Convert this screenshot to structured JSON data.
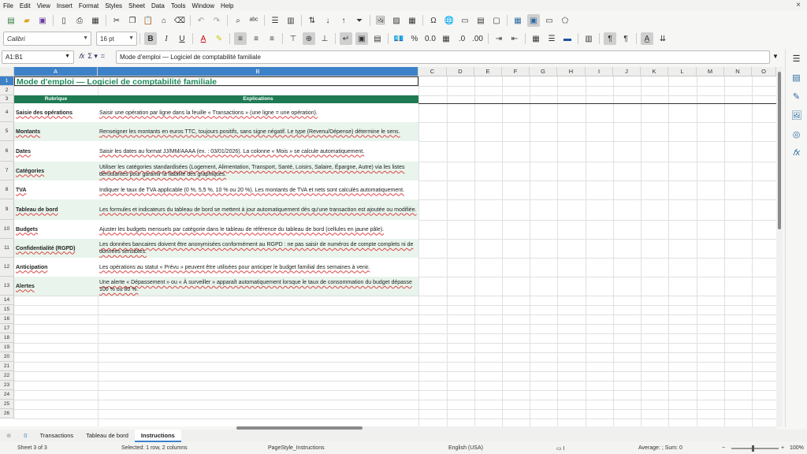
{
  "menu": [
    "File",
    "Edit",
    "View",
    "Insert",
    "Format",
    "Styles",
    "Sheet",
    "Data",
    "Tools",
    "Window",
    "Help"
  ],
  "font": {
    "name": "Calibri",
    "size": "16 pt"
  },
  "formula": {
    "namebox": "A1:B1",
    "content": "Mode d'emploi — Logiciel de comptabilité familiale"
  },
  "columns": [
    "A",
    "B",
    "C",
    "D",
    "E",
    "F",
    "G",
    "H",
    "I",
    "J",
    "K",
    "L",
    "M",
    "N",
    "O"
  ],
  "rows": [
    "1",
    "2",
    "3",
    "4",
    "5",
    "6",
    "7",
    "8",
    "9",
    "10",
    "11",
    "12",
    "13",
    "14",
    "15",
    "16",
    "17",
    "18",
    "19",
    "20",
    "21",
    "22",
    "23",
    "24",
    "25",
    "26"
  ],
  "sheet": {
    "title": "Mode d'emploi — Logiciel de comptabilité familiale",
    "header_rubrique": "Rubrique",
    "header_explications": "Explications",
    "entries": [
      {
        "rubrique": "Saisie des opérations",
        "explication": "Saisir une opération par ligne dans la feuille « Transactions » (une ligne = une opération)."
      },
      {
        "rubrique": "Montants",
        "explication": "Renseigner les montants en euros TTC, toujours positifs, sans signe négatif. Le type (Revenu/Dépense) détermine le sens."
      },
      {
        "rubrique": "Dates",
        "explication": "Saisir les dates au format JJ/MM/AAAA (ex. : 03/01/2026). La colonne « Mois » se calcule automatiquement."
      },
      {
        "rubrique": "Catégories",
        "explication": "Utiliser les catégories standardisées (Logement, Alimentation, Transport, Santé, Loisirs, Salaire, Épargne, Autre) via les listes déroulantes pour garantir la fiabilité des graphiques."
      },
      {
        "rubrique": "TVA",
        "explication": "Indiquer le taux de TVA applicable (0 %, 5,5 %, 10 % ou 20 %). Les montants de TVA et nets sont calculés automatiquement."
      },
      {
        "rubrique": "Tableau de bord",
        "explication": "Les formules et indicateurs du tableau de bord se mettent à jour automatiquement dès qu'une transaction est ajoutée ou modifiée."
      },
      {
        "rubrique": "Budgets",
        "explication": "Ajuster les budgets mensuels par catégorie dans le tableau de référence du tableau de bord (cellules en jaune pâle)."
      },
      {
        "rubrique": "Confidentialité (RGPD)",
        "explication": "Les données bancaires doivent être anonymisées conformément au RGPD : ne pas saisir de numéros de compte complets ni de données sensibles."
      },
      {
        "rubrique": "Anticipation",
        "explication": "Les opérations au statut « Prévu » peuvent être utilisées pour anticiper le budget familial des semaines à venir."
      },
      {
        "rubrique": "Alertes",
        "explication": "Une alerte « Dépassement » ou « À surveiller » apparaît automatiquement lorsque le taux de consommation du budget dépasse 100 % ou 80 %."
      }
    ]
  },
  "tabs": {
    "add": "⊕",
    "nav": "0",
    "items": [
      "Transactions",
      "Tableau de bord",
      "Instructions"
    ],
    "active": "Instructions"
  },
  "status": {
    "sheet": "Sheet 3 of 3",
    "selected": "Selected: 1 row, 2 columns",
    "pagestyle": "PageStyle_Instructions",
    "language": "English (USA)",
    "sum": "Average: ; Sum: 0",
    "zoom": "100%"
  },
  "colors": {
    "header_green": "#1e7a52",
    "title_green": "#1f8a5a",
    "selection_blue": "#3d82c8"
  }
}
